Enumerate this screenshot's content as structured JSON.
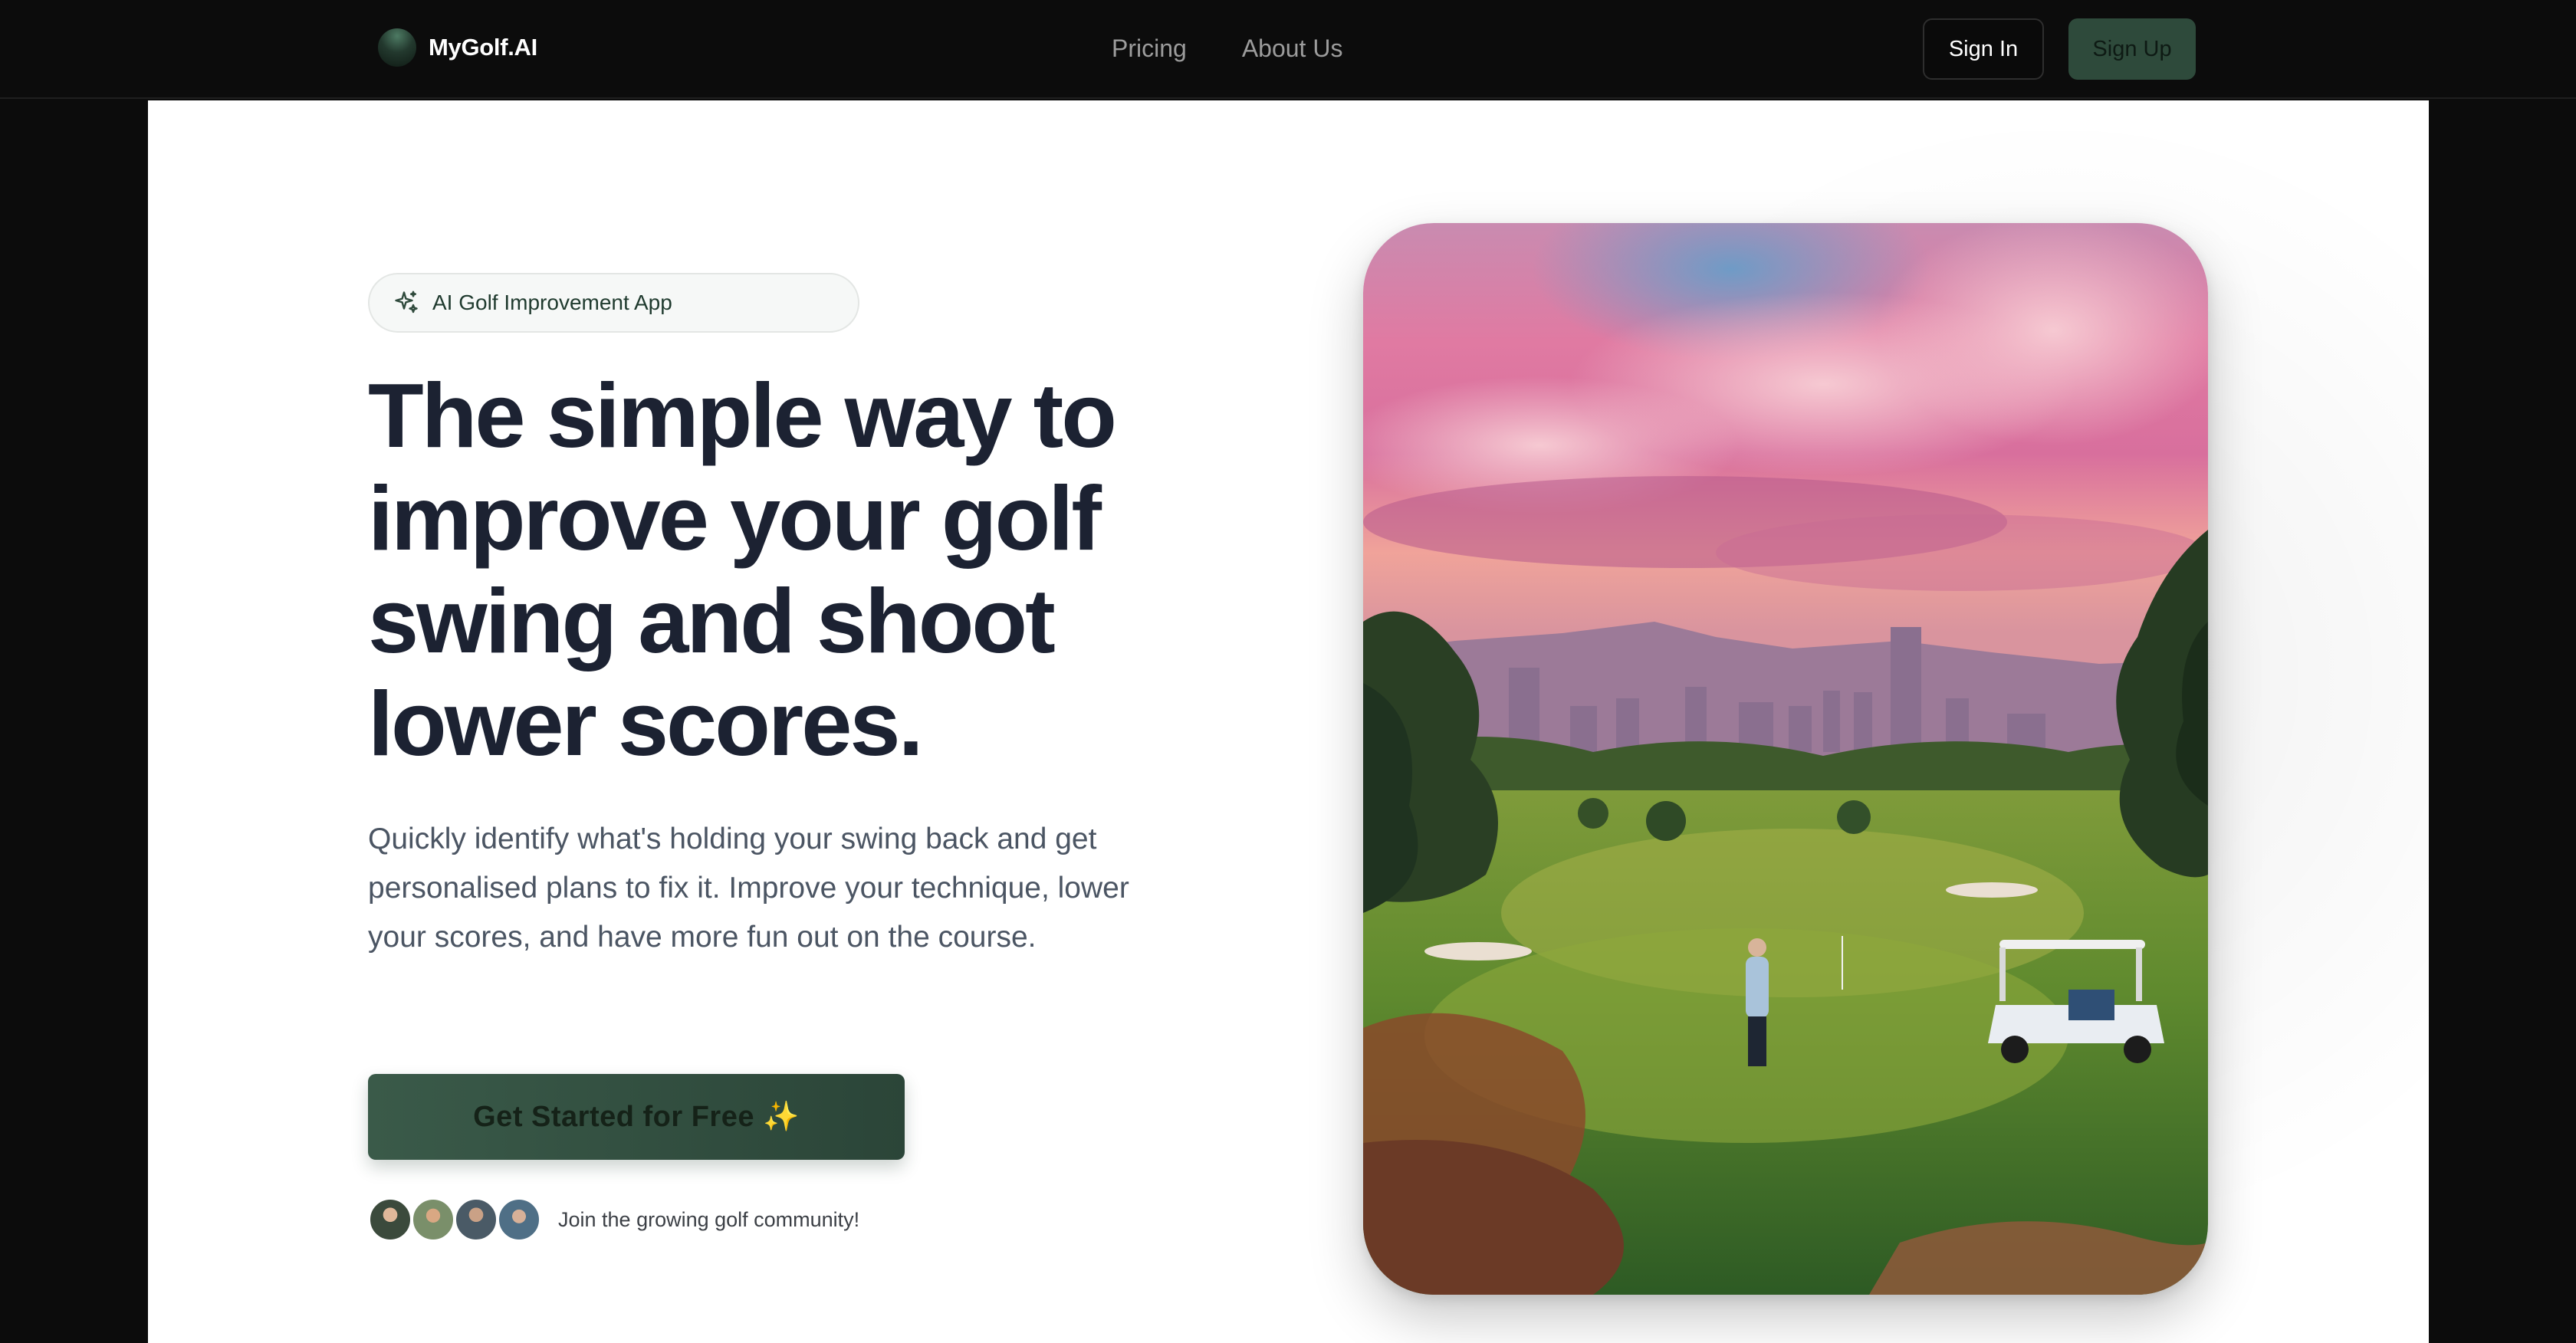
{
  "nav": {
    "brand": "MyGolf.AI",
    "links": [
      {
        "label": "Pricing"
      },
      {
        "label": "About Us"
      }
    ],
    "sign_in": "Sign In",
    "sign_up": "Sign Up"
  },
  "hero": {
    "badge": "AI Golf Improvement App",
    "headline": "The simple way to improve your golf swing and shoot lower scores.",
    "subtext": "Quickly identify what's holding your swing back and get personalised plans to fix it. Improve your technique, lower your scores, and have more fun out on the course.",
    "cta": "Get Started for Free ✨",
    "community": "Join the growing golf community!",
    "image_icon": "golf-course-sunset-image"
  },
  "colors": {
    "accent": "#2e4a3b",
    "headline": "#1c2232",
    "background": "#0c0c0c"
  }
}
